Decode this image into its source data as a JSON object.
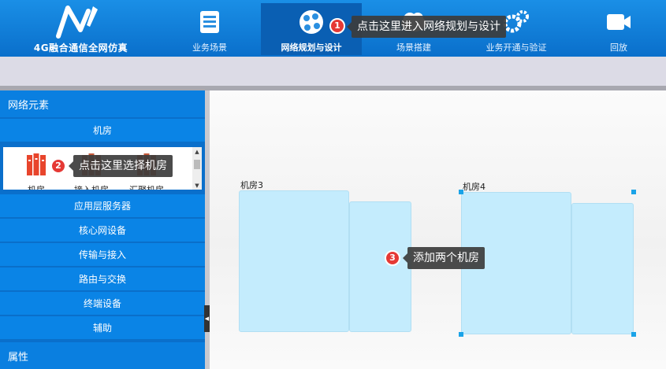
{
  "app": {
    "title": "4G融合通信全网仿真"
  },
  "nav": [
    {
      "label": "业务场景",
      "icon": "document-icon"
    },
    {
      "label": "网络规划与设计",
      "icon": "globe-icon"
    },
    {
      "label": "场景搭建",
      "icon": "cloud-icon"
    },
    {
      "label": "业务开通与验证",
      "icon": "gears-icon"
    },
    {
      "label": "回放",
      "icon": "video-camera-icon"
    }
  ],
  "left_panel": {
    "header": "网络元素",
    "active_category": "机房",
    "palette": [
      {
        "label": "机房"
      },
      {
        "label": "接入机房"
      },
      {
        "label": "汇聚机房"
      }
    ],
    "categories": [
      "应用层服务器",
      "核心网设备",
      "传输与接入",
      "路由与交换",
      "终端设备",
      "辅助"
    ],
    "properties_header": "属性"
  },
  "canvas": {
    "rooms": [
      {
        "label": "机房3"
      },
      {
        "label": "机房4"
      }
    ]
  },
  "tips": [
    {
      "num": "1",
      "text": "点击这里进入网络规划与设计"
    },
    {
      "num": "2",
      "text": "点击这里选择机房"
    },
    {
      "num": "3",
      "text": "添加两个机房"
    }
  ],
  "colors": {
    "header": "#0a6fcb",
    "panel": "#0a84e6",
    "room_fill": "#c4ecfd",
    "badge": "#e53935",
    "handle": "#1aa3e8"
  }
}
